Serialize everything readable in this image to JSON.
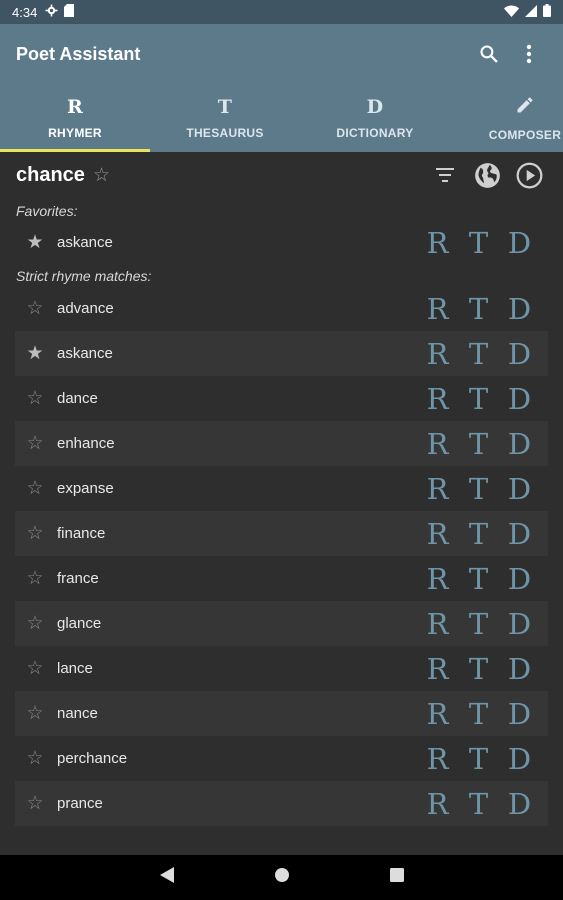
{
  "status": {
    "time": "4:34"
  },
  "app": {
    "title": "Poet Assistant"
  },
  "tabs": [
    {
      "glyph": "R",
      "label": "RHYMER"
    },
    {
      "glyph": "T",
      "label": "THESAURUS"
    },
    {
      "glyph": "D",
      "label": "DICTIONARY"
    },
    {
      "glyph": "",
      "label": "COMPOSER"
    }
  ],
  "query": {
    "word": "chance"
  },
  "favorites": {
    "label": "Favorites:",
    "items": [
      {
        "word": "askance",
        "starred": true
      }
    ]
  },
  "strict": {
    "label": "Strict rhyme matches:",
    "items": [
      {
        "word": "advance",
        "starred": false
      },
      {
        "word": "askance",
        "starred": true
      },
      {
        "word": "dance",
        "starred": false
      },
      {
        "word": "enhance",
        "starred": false
      },
      {
        "word": "expanse",
        "starred": false
      },
      {
        "word": "finance",
        "starred": false
      },
      {
        "word": "france",
        "starred": false
      },
      {
        "word": "glance",
        "starred": false
      },
      {
        "word": "lance",
        "starred": false
      },
      {
        "word": "nance",
        "starred": false
      },
      {
        "word": "perchance",
        "starred": false
      },
      {
        "word": "prance",
        "starred": false
      }
    ]
  },
  "row_actions": [
    "R",
    "T",
    "D"
  ],
  "colors": {
    "primary": "#5c7a8a",
    "accent": "#e7e35f",
    "action": "#6e95a8",
    "status": "#3f5563"
  }
}
